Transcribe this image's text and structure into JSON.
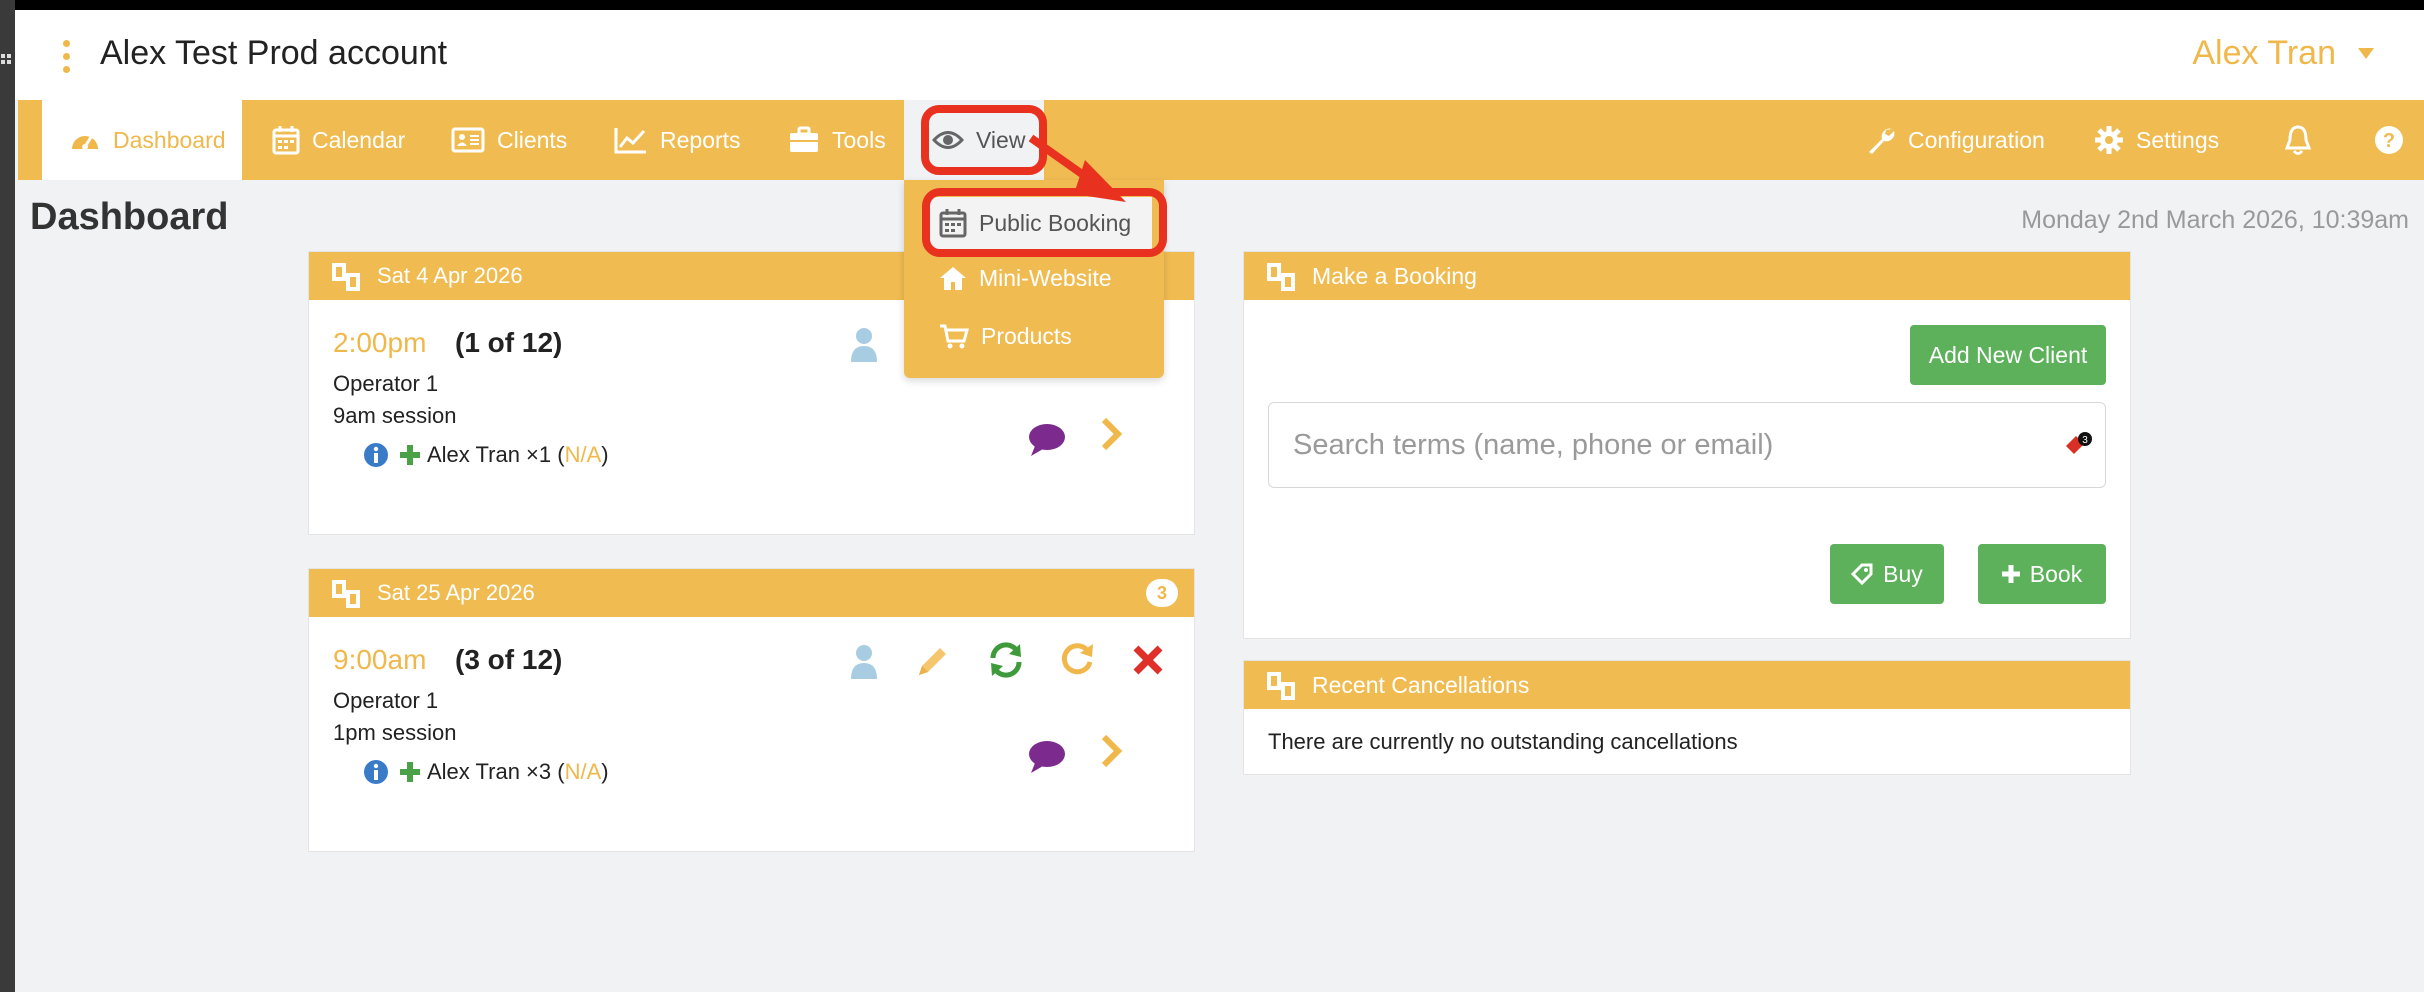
{
  "header": {
    "account_title": "Alex Test Prod account",
    "user_name": "Alex Tran"
  },
  "nav": {
    "items": [
      {
        "label": "Dashboard",
        "icon": "dashboard-icon",
        "active": true
      },
      {
        "label": "Calendar",
        "icon": "calendar-icon"
      },
      {
        "label": "Clients",
        "icon": "clients-icon"
      },
      {
        "label": "Reports",
        "icon": "reports-icon"
      },
      {
        "label": "Tools",
        "icon": "tools-icon"
      },
      {
        "label": "View",
        "icon": "eye-icon",
        "open": true
      }
    ],
    "right_items": [
      {
        "label": "Configuration",
        "icon": "wrench-icon"
      },
      {
        "label": "Settings",
        "icon": "gear-icon"
      },
      {
        "label": "",
        "icon": "bell-icon"
      },
      {
        "label": "",
        "icon": "help-icon"
      }
    ]
  },
  "view_menu": {
    "items": [
      {
        "label": "Public Booking",
        "icon": "calendar-icon"
      },
      {
        "label": "Mini-Website",
        "icon": "home-icon"
      },
      {
        "label": "Products",
        "icon": "cart-icon"
      }
    ]
  },
  "page": {
    "title": "Dashboard",
    "date": "Monday 2nd March 2026, 10:39am"
  },
  "sessions": [
    {
      "date": "Sat 4 Apr 2026",
      "time": "2:00pm",
      "count": "(1 of 12)",
      "operator": "Operator 1",
      "session_name": "9am session",
      "attendee": "Alex Tran ×1 (",
      "attendee_na": "N/A",
      "attendee_close": ")"
    },
    {
      "date": "Sat 25 Apr 2026",
      "badge": "3",
      "time": "9:00am",
      "count": "(3 of 12)",
      "operator": "Operator 1",
      "session_name": "1pm session",
      "attendee": "Alex Tran ×3 (",
      "attendee_na": "N/A",
      "attendee_close": ")"
    }
  ],
  "booking_panel": {
    "title": "Make a Booking",
    "add_client_label": "Add New Client",
    "search_placeholder": "Search terms (name, phone or email)",
    "buy_label": "Buy",
    "book_label": "Book"
  },
  "cancellations_panel": {
    "title": "Recent Cancellations",
    "message": "There are currently no outstanding cancellations"
  },
  "colors": {
    "accent": "#f0bc52",
    "highlight": "#e8321f",
    "success": "#5cb15a"
  }
}
